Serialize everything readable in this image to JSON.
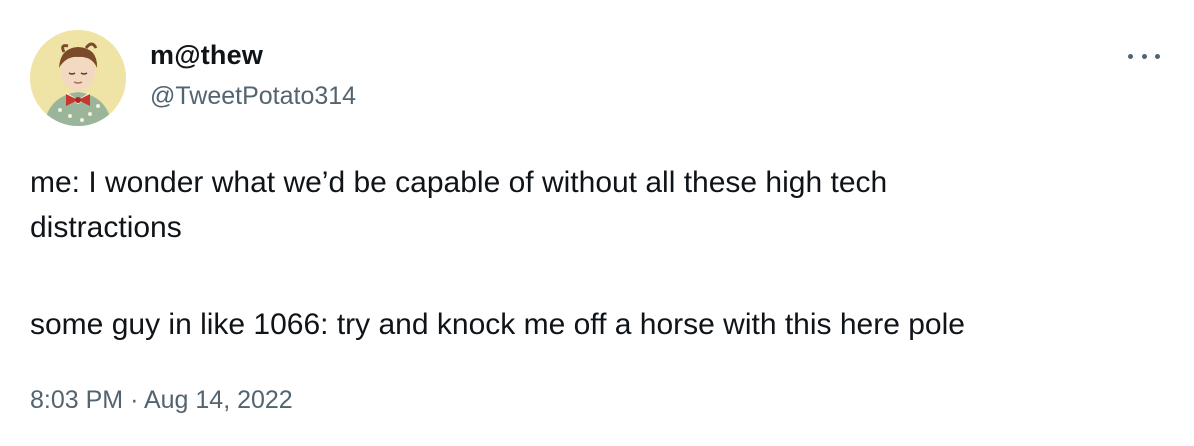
{
  "user": {
    "display_name": "m@thew",
    "handle": "@TweetPotato314",
    "avatar_icon": "child-with-bowtie-avatar"
  },
  "menu": {
    "icon": "more-horizontal-icon"
  },
  "tweet": {
    "lines": [
      "me: I wonder what we’d be capable of without all these high tech",
      "distractions",
      "some guy in like 1066: try and knock me off a horse with this here pole"
    ]
  },
  "meta": {
    "time": "8:03 PM",
    "separator": "·",
    "date": "Aug 14, 2022"
  },
  "colors": {
    "text": "#0f1419",
    "secondary": "#536471",
    "avatar_bg": "#efe3a6"
  }
}
